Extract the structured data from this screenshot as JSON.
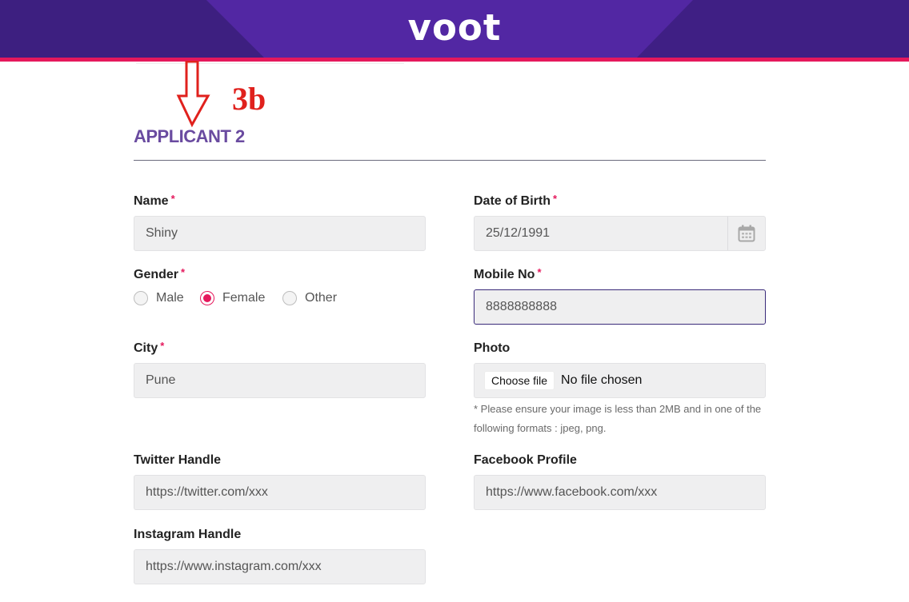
{
  "header": {
    "logo": "voot"
  },
  "annotation": {
    "label": "3b"
  },
  "section": {
    "title": "APPLICANT 2"
  },
  "form": {
    "name": {
      "label": "Name",
      "value": "Shiny"
    },
    "dob": {
      "label": "Date of Birth",
      "value": "25/12/1991"
    },
    "gender": {
      "label": "Gender",
      "options": [
        "Male",
        "Female",
        "Other"
      ],
      "selected": "Female"
    },
    "mobile": {
      "label": "Mobile No",
      "value": "8888888888"
    },
    "city": {
      "label": "City",
      "value": "Pune"
    },
    "photo": {
      "label": "Photo",
      "button": "Choose file",
      "status": "No file chosen",
      "hint": "* Please ensure your image is less than 2MB and in one of the following formats : jpeg, png."
    },
    "twitter": {
      "label": "Twitter Handle",
      "placeholder": "https://twitter.com/xxx"
    },
    "facebook": {
      "label": "Facebook Profile",
      "placeholder": "https://www.facebook.com/xxx"
    },
    "instagram": {
      "label": "Instagram Handle",
      "placeholder": "https://www.instagram.com/xxx"
    },
    "required_mark": "*"
  },
  "colors": {
    "header_bg": "#4a2593",
    "accent_pink": "#e5185c",
    "title_purple": "#6a4ba0",
    "annotation_red": "#e0211d"
  }
}
